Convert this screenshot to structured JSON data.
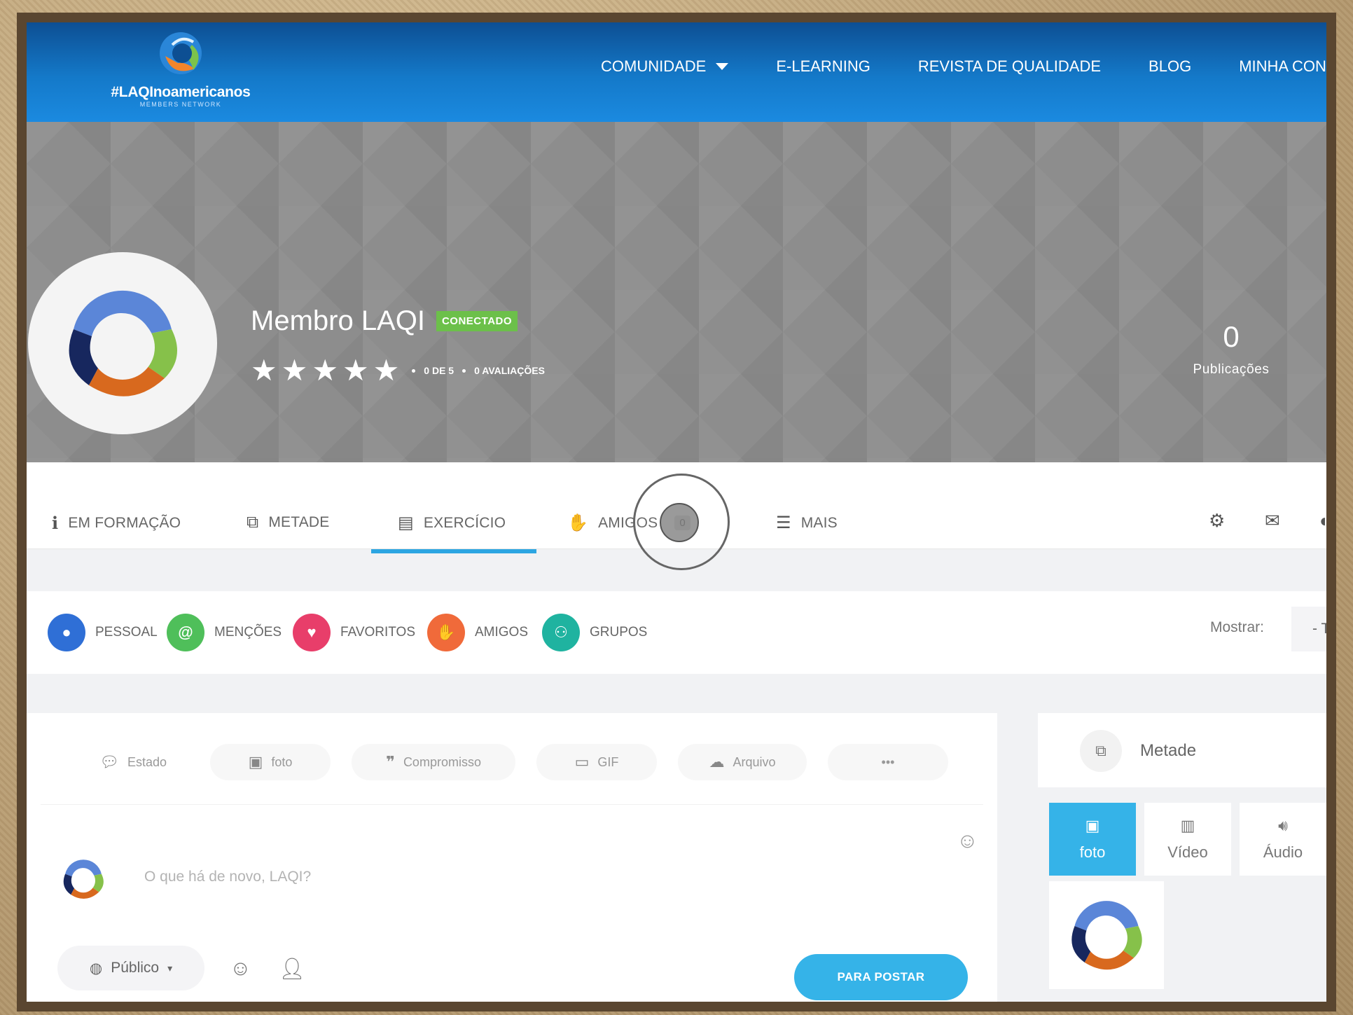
{
  "logo": {
    "text": "#LAQInoamericanos",
    "subtitle": "MEMBERS NETWORK"
  },
  "nav": {
    "items": [
      {
        "label": "COMUNIDADE",
        "has_dropdown": true
      },
      {
        "label": "E-LEARNING"
      },
      {
        "label": "REVISTA DE QUALIDADE"
      },
      {
        "label": "BLOG"
      },
      {
        "label": "MINHA CON"
      }
    ]
  },
  "profile": {
    "name": "Membro LAQI",
    "status_badge": "CONECTADO",
    "stars_filled": 5,
    "star_glyphs": [
      "★",
      "★",
      "★",
      "★",
      "★"
    ],
    "rating_text": "0 DE 5",
    "reviews_text": "0 AVALIAÇÕES",
    "stats": [
      {
        "value": "0",
        "label": "Publicações"
      }
    ]
  },
  "tabs": {
    "items": [
      {
        "label": "EM FORMAÇÃO",
        "icon": "info-icon"
      },
      {
        "label": "METADE",
        "icon": "media-icon"
      },
      {
        "label": "EXERCÍCIO",
        "icon": "id-card-icon",
        "active": true
      },
      {
        "label": "AMIGOS",
        "icon": "handshake-icon",
        "count": "0"
      },
      {
        "label": "MAIS",
        "icon": "menu-icon"
      }
    ]
  },
  "filters": {
    "items": [
      {
        "label": "PESSOAL",
        "icon": "user-icon",
        "color": "#2f6fd6"
      },
      {
        "label": "MENÇÕES",
        "icon": "at-icon",
        "color": "#4fbf5a"
      },
      {
        "label": "FAVORITOS",
        "icon": "heart-icon",
        "color": "#e83e6a"
      },
      {
        "label": "AMIGOS",
        "icon": "handshake-icon",
        "color": "#f06a3a"
      },
      {
        "label": "GRUPOS",
        "icon": "group-icon",
        "color": "#1fb3a0"
      }
    ],
    "show_label": "Mostrar:",
    "show_value": "- T"
  },
  "composer": {
    "tabs": [
      {
        "label": "Estado",
        "icon": "chat-icon"
      },
      {
        "label": "foto",
        "icon": "photo-icon"
      },
      {
        "label": "Compromisso",
        "icon": "quote-icon"
      },
      {
        "label": "GIF",
        "icon": "gif-icon"
      },
      {
        "label": "Arquivo",
        "icon": "cloud-upload-icon"
      },
      {
        "label": "•••",
        "icon": "more-icon"
      }
    ],
    "placeholder": "O que há de novo, LAQI?",
    "privacy": "Público",
    "post_button": "PARA POSTAR"
  },
  "sidebar": {
    "title": "Metade",
    "media_tabs": [
      {
        "label": "foto",
        "icon": "image-icon",
        "active": true
      },
      {
        "label": "Vídeo",
        "icon": "film-icon"
      },
      {
        "label": "Áudio",
        "icon": "speaker-icon"
      }
    ]
  },
  "colors": {
    "brand_blue": "#1479c9",
    "accent": "#35b3e8",
    "badge_green": "#6cc04a"
  }
}
